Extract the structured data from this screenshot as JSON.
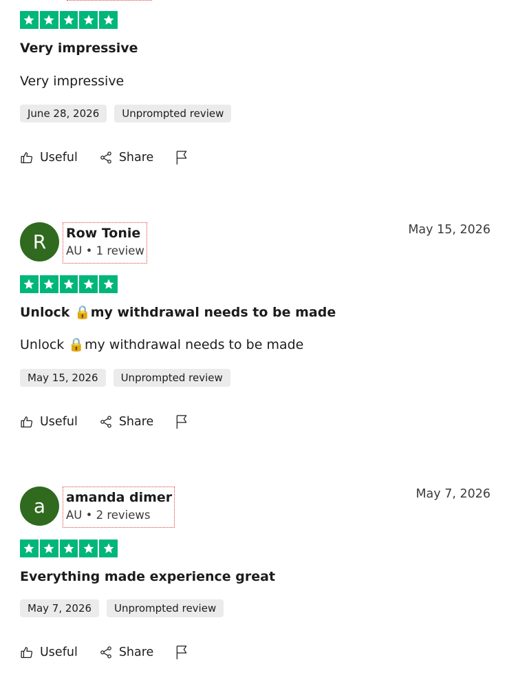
{
  "colors": {
    "star_green": "#00b67a",
    "avatar_green": "#2f6a1f",
    "tag_bg": "#ebebeb",
    "highlight_border": "#d9403a"
  },
  "actions": {
    "useful_label": "Useful",
    "share_label": "Share",
    "useful_icon": "thumbs-up-icon",
    "share_icon": "share-icon",
    "report_icon": "flag-icon"
  },
  "reviews": [
    {
      "rating": 5,
      "title": "Very impressive",
      "body": "Very impressive",
      "date_tag": "June 28, 2026",
      "source_tag": "Unprompted review"
    },
    {
      "avatar_letter": "R",
      "name": "Row Tonie",
      "meta": "AU • 1 review",
      "date": "May 15, 2026",
      "rating": 5,
      "title": "Unlock 🔒my withdrawal needs to be made",
      "body": "Unlock 🔒my withdrawal needs to be made",
      "date_tag": "May 15, 2026",
      "source_tag": "Unprompted review"
    },
    {
      "avatar_letter": "a",
      "name": "amanda dimer",
      "meta": "AU • 2 reviews",
      "date": "May 7, 2026",
      "rating": 5,
      "title": "Everything made experience great",
      "date_tag": "May 7, 2026",
      "source_tag": "Unprompted review"
    }
  ]
}
